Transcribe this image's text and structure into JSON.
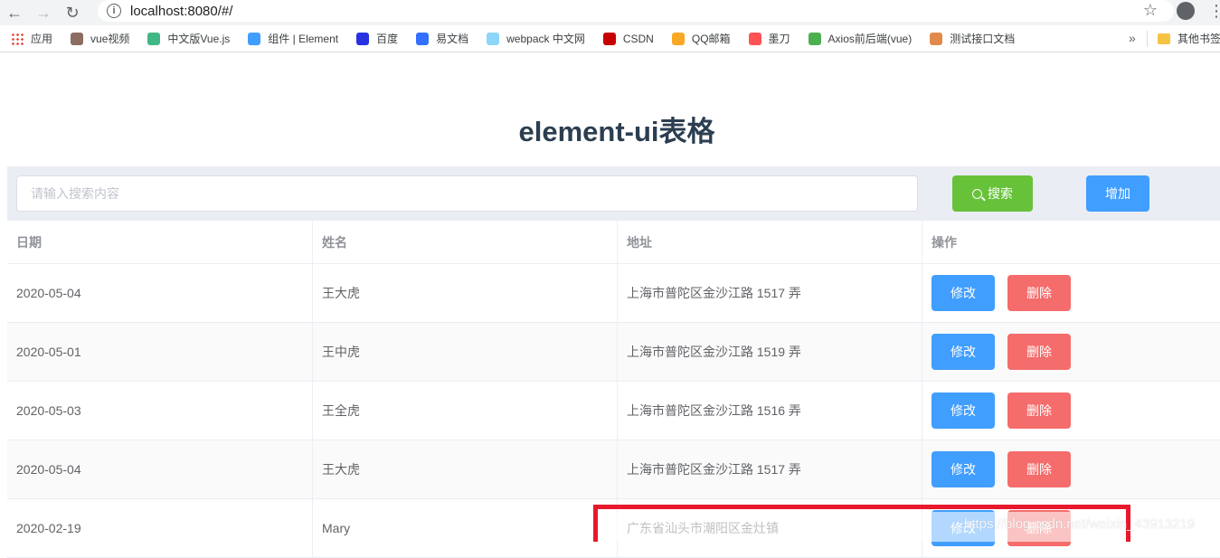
{
  "browser": {
    "url": "localhost:8080/#/",
    "back_icon": "back-arrow-icon",
    "forward_icon": "forward-arrow-icon",
    "reload_icon": "reload-icon"
  },
  "bookmarks": {
    "items": [
      {
        "label": "应用",
        "color": "#ea4335"
      },
      {
        "label": "vue视频",
        "color": "#8c6d62"
      },
      {
        "label": "中文版Vue.js",
        "color": "#41b883"
      },
      {
        "label": "组件 | Element",
        "color": "#409eff"
      },
      {
        "label": "百度",
        "color": "#2932e1"
      },
      {
        "label": "易文档",
        "color": "#3370ff"
      },
      {
        "label": "webpack 中文网",
        "color": "#8dd6f9"
      },
      {
        "label": "CSDN",
        "color": "#c90000"
      },
      {
        "label": "QQ邮箱",
        "color": "#f9a825"
      },
      {
        "label": "墨刀",
        "color": "#ff5252"
      },
      {
        "label": "Axios前后端(vue)",
        "color": "#4caf50"
      },
      {
        "label": "测试接口文档",
        "color": "#e08b4b"
      }
    ],
    "overflow": "»",
    "other": "其他书签"
  },
  "page": {
    "title": "element-ui表格",
    "search": {
      "placeholder": "请输入搜索内容",
      "search_label": "搜索",
      "add_label": "增加"
    },
    "table": {
      "headers": [
        "日期",
        "姓名",
        "地址",
        "操作"
      ],
      "edit_label": "修改",
      "delete_label": "删除",
      "rows": [
        {
          "date": "2020-05-04",
          "name": "王大虎",
          "address": "上海市普陀区金沙江路 1517 弄"
        },
        {
          "date": "2020-05-01",
          "name": "王中虎",
          "address": "上海市普陀区金沙江路 1519 弄"
        },
        {
          "date": "2020-05-03",
          "name": "王全虎",
          "address": "上海市普陀区金沙江路 1516 弄"
        },
        {
          "date": "2020-05-04",
          "name": "王大虎",
          "address": "上海市普陀区金沙江路 1517 弄"
        },
        {
          "date": "2020-02-19",
          "name": "Mary",
          "address": "广东省汕头市潮阳区金灶镇"
        }
      ]
    }
  },
  "watermark": "https://blog.csdn.net/weixin_43913219",
  "colors": {
    "primary": "#409eff",
    "success": "#67c23a",
    "danger": "#f56c6c",
    "annotation": "#e8192c"
  }
}
